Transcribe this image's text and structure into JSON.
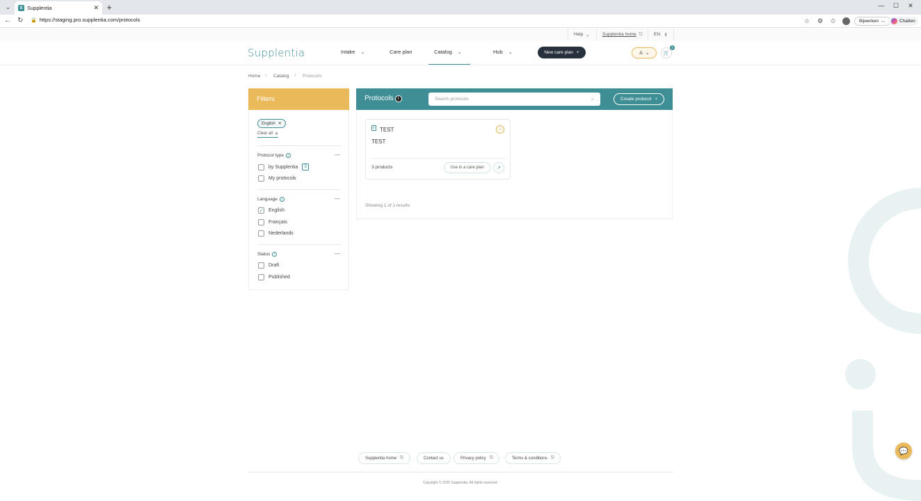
{
  "browser": {
    "tab_title": "Supplentia",
    "url": "https://staging.pro.supplentia.com/protocols",
    "update_label": "Bijwerken",
    "chat_label": "Chatten"
  },
  "utility": {
    "help": "Help",
    "home_link": "Supplentia home",
    "language": "EN"
  },
  "header": {
    "logo": "Supplentia",
    "nav": [
      "Intake",
      "Care plan",
      "Catalog",
      "Hub"
    ],
    "new_plan": "New care plan",
    "cart_count": "2"
  },
  "breadcrumb": [
    "Home",
    "Catalog",
    "Protocols"
  ],
  "filters": {
    "title": "Filters",
    "active_chip": "English",
    "clear_all": "Clear all",
    "groups": [
      {
        "title": "Protocol type",
        "options": [
          {
            "label": "by Supplentia",
            "checked": false
          },
          {
            "label": "My protocols",
            "checked": false
          }
        ]
      },
      {
        "title": "Language",
        "options": [
          {
            "label": "English",
            "checked": true
          },
          {
            "label": "Français",
            "checked": false
          },
          {
            "label": "Nederlands",
            "checked": false
          }
        ]
      },
      {
        "title": "Status",
        "options": [
          {
            "label": "Draft",
            "checked": false
          },
          {
            "label": "Published",
            "checked": false
          }
        ]
      }
    ]
  },
  "protocols": {
    "title": "Protocols",
    "search_placeholder": "Search protocols",
    "create": "Create protocol",
    "card": {
      "title": "TEST",
      "description": "TEST",
      "products": "3 products",
      "use_button": "Use in a care plan"
    },
    "results": "Showing 1 of 1 results"
  },
  "footer": {
    "links": [
      "Supplentia home",
      "Contact us",
      "Privacy policy",
      "Terms & conditions"
    ],
    "copyright": "Copyright © 2025 Supplentia. All rights reserved."
  },
  "colors": {
    "teal": "#3e8e95",
    "gold": "#eab95a",
    "dark": "#27313d"
  }
}
